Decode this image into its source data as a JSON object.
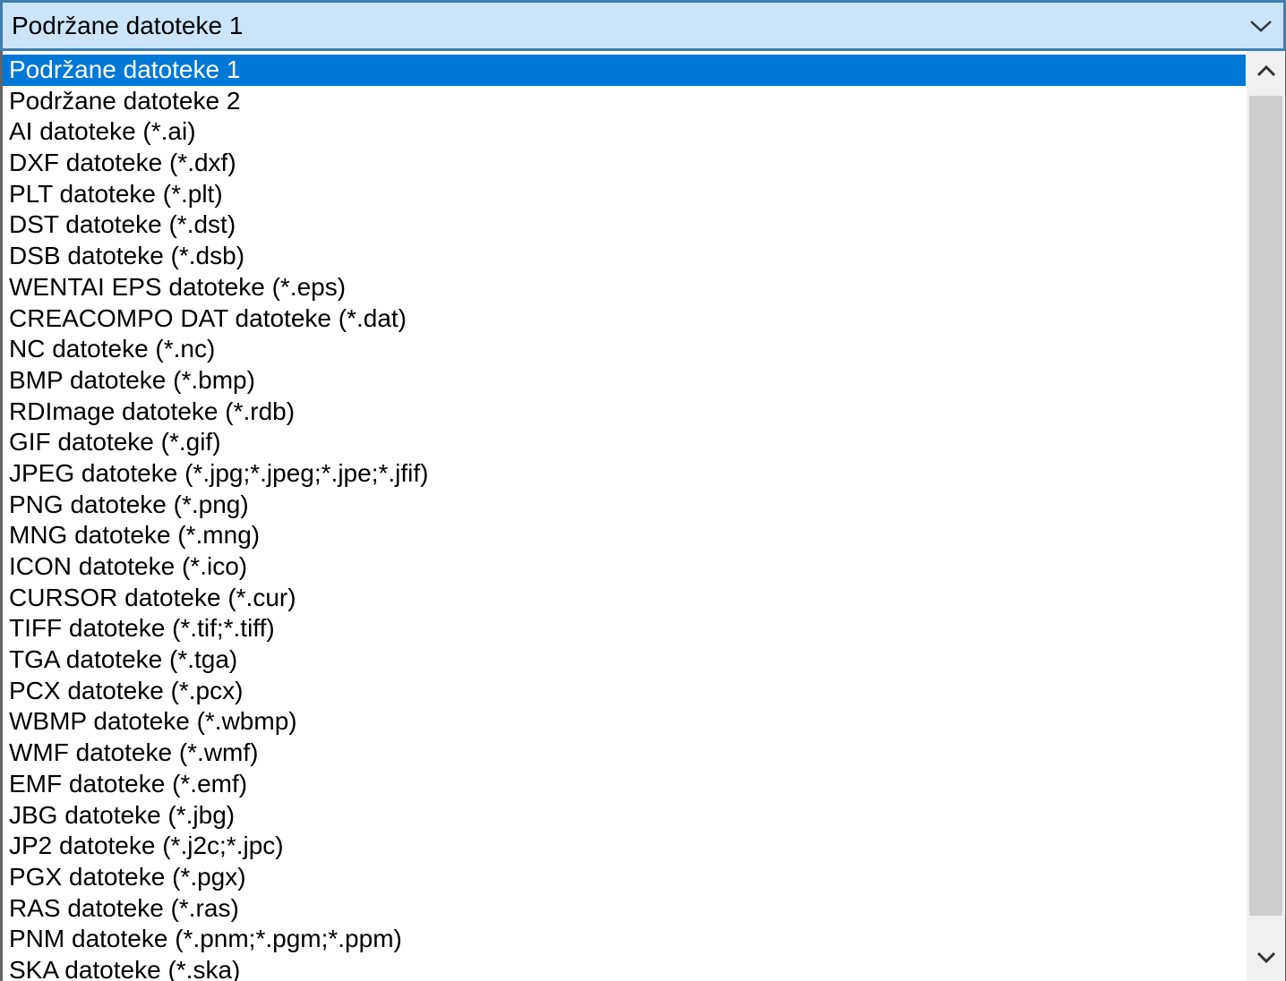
{
  "combo": {
    "selected_value": "Podržane datoteke 1",
    "arrow_icon": "chevron-down-icon"
  },
  "list": {
    "selected_index": 0,
    "items": [
      "Podržane datoteke 1",
      "Podržane datoteke 2",
      "AI datoteke (*.ai)",
      "DXF datoteke (*.dxf)",
      "PLT datoteke (*.plt)",
      "DST datoteke (*.dst)",
      "DSB datoteke (*.dsb)",
      "WENTAI EPS datoteke (*.eps)",
      "CREACOMPO DAT datoteke (*.dat)",
      "NC datoteke (*.nc)",
      "BMP datoteke (*.bmp)",
      "RDImage datoteke (*.rdb)",
      "GIF datoteke (*.gif)",
      "JPEG datoteke (*.jpg;*.jpeg;*.jpe;*.jfif)",
      "PNG datoteke (*.png)",
      "MNG datoteke (*.mng)",
      "ICON datoteke (*.ico)",
      "CURSOR datoteke (*.cur)",
      "TIFF datoteke (*.tif;*.tiff)",
      "TGA datoteke (*.tga)",
      "PCX datoteke (*.pcx)",
      "WBMP datoteke (*.wbmp)",
      "WMF datoteke (*.wmf)",
      "EMF datoteke (*.emf)",
      "JBG datoteke (*.jbg)",
      "JP2 datoteke (*.j2c;*.jpc)",
      "PGX datoteke (*.pgx)",
      "RAS datoteke (*.ras)",
      "PNM datoteke (*.pnm;*.pgm;*.ppm)",
      "SKA datoteke (*.ska)"
    ]
  },
  "scrollbar": {
    "up_icon": "chevron-up-icon",
    "down_icon": "chevron-down-icon"
  },
  "colors": {
    "selection": "#0078d7",
    "combo_background": "#cce4f7",
    "combo_border": "#3c7fb1",
    "scrollbar_thumb": "#cdcdcd"
  }
}
